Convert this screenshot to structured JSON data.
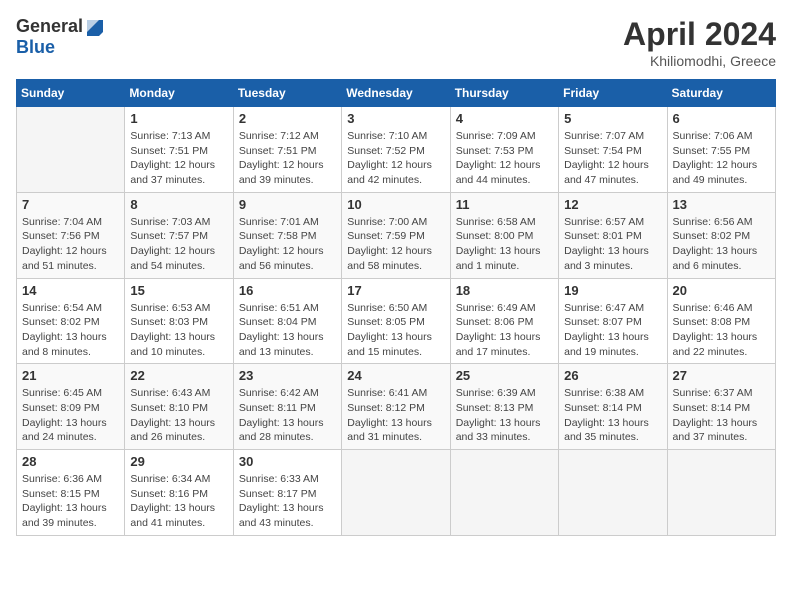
{
  "header": {
    "logo_general": "General",
    "logo_blue": "Blue",
    "month": "April 2024",
    "location": "Khiliomodhi, Greece"
  },
  "weekdays": [
    "Sunday",
    "Monday",
    "Tuesday",
    "Wednesday",
    "Thursday",
    "Friday",
    "Saturday"
  ],
  "weeks": [
    [
      {
        "day": "",
        "content": ""
      },
      {
        "day": "1",
        "content": "Sunrise: 7:13 AM\nSunset: 7:51 PM\nDaylight: 12 hours\nand 37 minutes."
      },
      {
        "day": "2",
        "content": "Sunrise: 7:12 AM\nSunset: 7:51 PM\nDaylight: 12 hours\nand 39 minutes."
      },
      {
        "day": "3",
        "content": "Sunrise: 7:10 AM\nSunset: 7:52 PM\nDaylight: 12 hours\nand 42 minutes."
      },
      {
        "day": "4",
        "content": "Sunrise: 7:09 AM\nSunset: 7:53 PM\nDaylight: 12 hours\nand 44 minutes."
      },
      {
        "day": "5",
        "content": "Sunrise: 7:07 AM\nSunset: 7:54 PM\nDaylight: 12 hours\nand 47 minutes."
      },
      {
        "day": "6",
        "content": "Sunrise: 7:06 AM\nSunset: 7:55 PM\nDaylight: 12 hours\nand 49 minutes."
      }
    ],
    [
      {
        "day": "7",
        "content": "Sunrise: 7:04 AM\nSunset: 7:56 PM\nDaylight: 12 hours\nand 51 minutes."
      },
      {
        "day": "8",
        "content": "Sunrise: 7:03 AM\nSunset: 7:57 PM\nDaylight: 12 hours\nand 54 minutes."
      },
      {
        "day": "9",
        "content": "Sunrise: 7:01 AM\nSunset: 7:58 PM\nDaylight: 12 hours\nand 56 minutes."
      },
      {
        "day": "10",
        "content": "Sunrise: 7:00 AM\nSunset: 7:59 PM\nDaylight: 12 hours\nand 58 minutes."
      },
      {
        "day": "11",
        "content": "Sunrise: 6:58 AM\nSunset: 8:00 PM\nDaylight: 13 hours\nand 1 minute."
      },
      {
        "day": "12",
        "content": "Sunrise: 6:57 AM\nSunset: 8:01 PM\nDaylight: 13 hours\nand 3 minutes."
      },
      {
        "day": "13",
        "content": "Sunrise: 6:56 AM\nSunset: 8:02 PM\nDaylight: 13 hours\nand 6 minutes."
      }
    ],
    [
      {
        "day": "14",
        "content": "Sunrise: 6:54 AM\nSunset: 8:02 PM\nDaylight: 13 hours\nand 8 minutes."
      },
      {
        "day": "15",
        "content": "Sunrise: 6:53 AM\nSunset: 8:03 PM\nDaylight: 13 hours\nand 10 minutes."
      },
      {
        "day": "16",
        "content": "Sunrise: 6:51 AM\nSunset: 8:04 PM\nDaylight: 13 hours\nand 13 minutes."
      },
      {
        "day": "17",
        "content": "Sunrise: 6:50 AM\nSunset: 8:05 PM\nDaylight: 13 hours\nand 15 minutes."
      },
      {
        "day": "18",
        "content": "Sunrise: 6:49 AM\nSunset: 8:06 PM\nDaylight: 13 hours\nand 17 minutes."
      },
      {
        "day": "19",
        "content": "Sunrise: 6:47 AM\nSunset: 8:07 PM\nDaylight: 13 hours\nand 19 minutes."
      },
      {
        "day": "20",
        "content": "Sunrise: 6:46 AM\nSunset: 8:08 PM\nDaylight: 13 hours\nand 22 minutes."
      }
    ],
    [
      {
        "day": "21",
        "content": "Sunrise: 6:45 AM\nSunset: 8:09 PM\nDaylight: 13 hours\nand 24 minutes."
      },
      {
        "day": "22",
        "content": "Sunrise: 6:43 AM\nSunset: 8:10 PM\nDaylight: 13 hours\nand 26 minutes."
      },
      {
        "day": "23",
        "content": "Sunrise: 6:42 AM\nSunset: 8:11 PM\nDaylight: 13 hours\nand 28 minutes."
      },
      {
        "day": "24",
        "content": "Sunrise: 6:41 AM\nSunset: 8:12 PM\nDaylight: 13 hours\nand 31 minutes."
      },
      {
        "day": "25",
        "content": "Sunrise: 6:39 AM\nSunset: 8:13 PM\nDaylight: 13 hours\nand 33 minutes."
      },
      {
        "day": "26",
        "content": "Sunrise: 6:38 AM\nSunset: 8:14 PM\nDaylight: 13 hours\nand 35 minutes."
      },
      {
        "day": "27",
        "content": "Sunrise: 6:37 AM\nSunset: 8:14 PM\nDaylight: 13 hours\nand 37 minutes."
      }
    ],
    [
      {
        "day": "28",
        "content": "Sunrise: 6:36 AM\nSunset: 8:15 PM\nDaylight: 13 hours\nand 39 minutes."
      },
      {
        "day": "29",
        "content": "Sunrise: 6:34 AM\nSunset: 8:16 PM\nDaylight: 13 hours\nand 41 minutes."
      },
      {
        "day": "30",
        "content": "Sunrise: 6:33 AM\nSunset: 8:17 PM\nDaylight: 13 hours\nand 43 minutes."
      },
      {
        "day": "",
        "content": ""
      },
      {
        "day": "",
        "content": ""
      },
      {
        "day": "",
        "content": ""
      },
      {
        "day": "",
        "content": ""
      }
    ]
  ]
}
